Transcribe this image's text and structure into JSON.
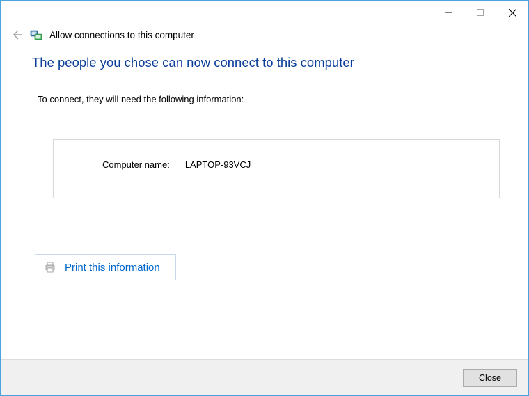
{
  "header": {
    "title": "Allow connections to this computer"
  },
  "main": {
    "heading": "The people you chose can now connect to this computer",
    "instruction": "To connect, they will need the following information:",
    "info": {
      "computer_name_label": "Computer name:",
      "computer_name_value": "LAPTOP-93VCJ"
    },
    "print_label": "Print this information"
  },
  "footer": {
    "close_label": "Close"
  }
}
